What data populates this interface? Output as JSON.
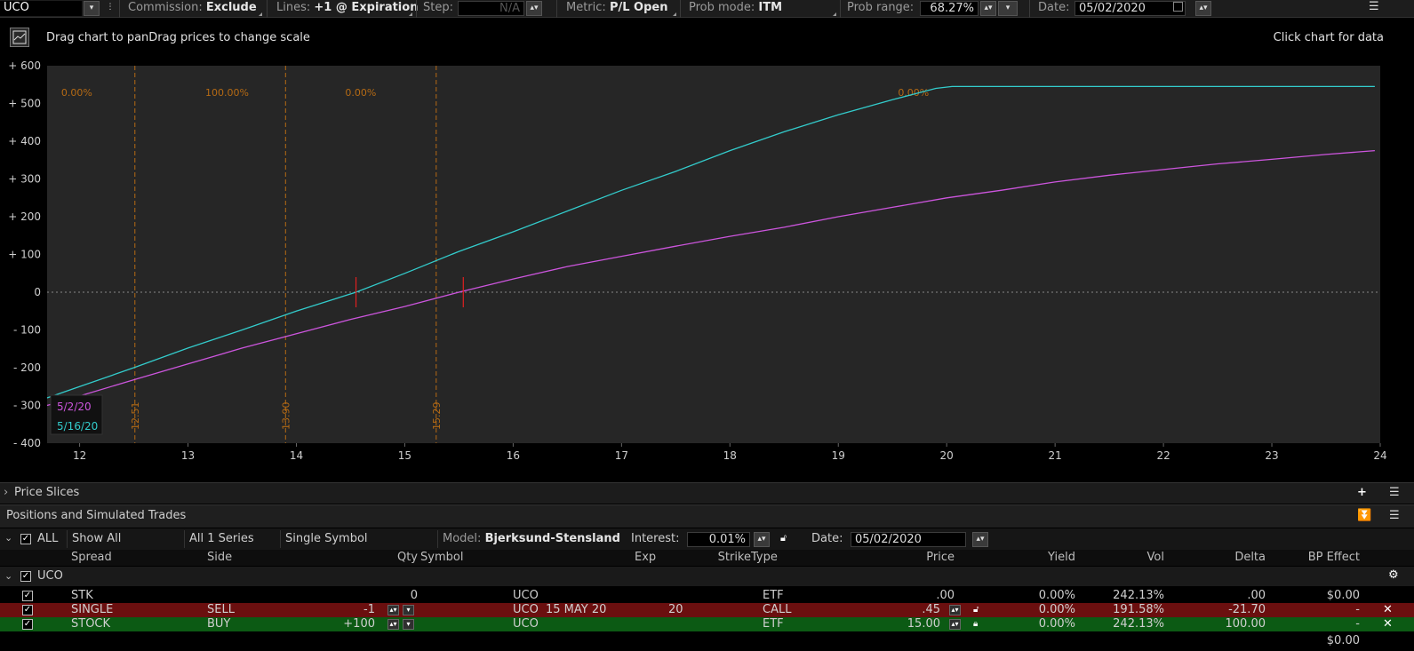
{
  "toolbar": {
    "symbol": "UCO",
    "commission_label": "Commission:",
    "commission_value": "Exclude",
    "lines_label": "Lines:",
    "lines_value": "+1 @ Expiration",
    "step_label": "Step:",
    "step_value": "N/A",
    "metric_label": "Metric:",
    "metric_value": "P/L Open",
    "probmode_label": "Prob mode:",
    "probmode_value": "ITM",
    "probrange_label": "Prob range:",
    "probrange_value": "68.27%",
    "date_label": "Date:",
    "date_value": "05/02/2020"
  },
  "chart_header": {
    "hint_left": "Drag chart to panDrag prices to change scale",
    "hint_right": "Click chart for data",
    "icon": "chart-icon"
  },
  "chart_data": {
    "type": "line",
    "xlim": [
      11.7,
      24.0
    ],
    "ylim": [
      -400,
      600
    ],
    "x_ticks": [
      "12",
      "13",
      "14",
      "15",
      "16",
      "17",
      "18",
      "19",
      "20",
      "21",
      "22",
      "23",
      "24"
    ],
    "y_ticks": [
      "+ 600",
      "+ 500",
      "+ 400",
      "+ 300",
      "+ 200",
      "+ 100",
      "0",
      "- 100",
      "- 200",
      "- 300",
      "- 400"
    ],
    "y_tick_values": [
      600,
      500,
      400,
      300,
      200,
      100,
      0,
      -100,
      -200,
      -300,
      -400
    ],
    "x_tick_values": [
      12,
      13,
      14,
      15,
      16,
      17,
      18,
      19,
      20,
      21,
      22,
      23,
      24
    ],
    "prob_lines": [
      {
        "x": 12.51,
        "label": "12.51"
      },
      {
        "x": 13.9,
        "label": "13.90"
      },
      {
        "x": 15.29,
        "label": "15.29"
      }
    ],
    "prob_labels": [
      {
        "x": 11.83,
        "text": "0.00%"
      },
      {
        "x": 13.16,
        "text": "100.00%"
      },
      {
        "x": 14.45,
        "text": "0.00%"
      },
      {
        "x": 19.55,
        "text": "0.00%"
      }
    ],
    "series": [
      {
        "name": "5/2/20",
        "color": "#cc55dd",
        "x": [
          11.7,
          12,
          12.5,
          13,
          13.5,
          14,
          14.5,
          15,
          15.5,
          16,
          16.5,
          17,
          17.5,
          18,
          18.5,
          19,
          19.5,
          20,
          20.5,
          21,
          21.5,
          22,
          22.5,
          23,
          23.5,
          23.95
        ],
        "y": [
          -300,
          -275,
          -232,
          -190,
          -148,
          -110,
          -72,
          -38,
          0,
          35,
          68,
          95,
          122,
          148,
          172,
          200,
          225,
          250,
          270,
          292,
          310,
          325,
          340,
          352,
          365,
          375
        ]
      },
      {
        "name": "5/16/20",
        "color": "#33cccc",
        "x": [
          11.7,
          12,
          12.5,
          13,
          13.5,
          14,
          14.55,
          15,
          15.5,
          16,
          16.5,
          17,
          17.5,
          18,
          18.5,
          19,
          19.5,
          19.9,
          20.05,
          21,
          22,
          23,
          23.95
        ],
        "y": [
          -280,
          -250,
          -200,
          -148,
          -100,
          -50,
          0,
          50,
          108,
          160,
          215,
          270,
          320,
          375,
          425,
          470,
          510,
          540,
          545,
          545,
          545,
          545,
          545
        ]
      }
    ],
    "breakevens": [
      14.55,
      15.54
    ],
    "legend": [
      "5/2/20",
      "5/16/20"
    ]
  },
  "price_slices": {
    "label": "Price Slices"
  },
  "positions": {
    "title": "Positions and Simulated Trades",
    "filter_all": "ALL",
    "show_all": "Show All",
    "series": "All 1 Series",
    "single_symbol": "Single Symbol",
    "model_label": "Model:",
    "model_value": "Bjerksund-Stensland",
    "interest_label": "Interest:",
    "interest_value": "0.01%",
    "date_label": "Date:",
    "date_value": "05/02/2020",
    "columns": [
      "Spread",
      "Side",
      "Qty",
      "Symbol",
      "Exp",
      "Strike",
      "Type",
      "Price",
      "Yield",
      "Vol",
      "Delta",
      "BP Effect"
    ],
    "group_label": "UCO",
    "rows": [
      {
        "spread": "STK",
        "side": "",
        "qty": "0",
        "symbol": "UCO",
        "exp": "",
        "strike": "",
        "type": "ETF",
        "price": ".00",
        "yield": "0.00%",
        "vol": "242.13%",
        "delta": ".00",
        "bp": "$0.00",
        "style": "plain"
      },
      {
        "spread": "SINGLE",
        "side": "SELL",
        "qty": "-1",
        "symbol": "UCO",
        "exp": "15 MAY 20",
        "strike": "20",
        "type": "CALL",
        "price": ".45",
        "yield": "0.00%",
        "vol": "191.58%",
        "delta": "-21.70",
        "bp": "-",
        "style": "sell"
      },
      {
        "spread": "STOCK",
        "side": "BUY",
        "qty": "+100",
        "symbol": "UCO",
        "exp": "",
        "strike": "",
        "type": "ETF",
        "price": "15.00",
        "yield": "0.00%",
        "vol": "242.13%",
        "delta": "100.00",
        "bp": "-",
        "style": "buy"
      }
    ],
    "total_bp": "$0.00"
  },
  "colors": {
    "sell_row": "#6b0f0f",
    "buy_row": "#0c5a14",
    "cyan": "#33cccc",
    "magenta": "#cc55dd",
    "prob_line": "#b56a14"
  }
}
